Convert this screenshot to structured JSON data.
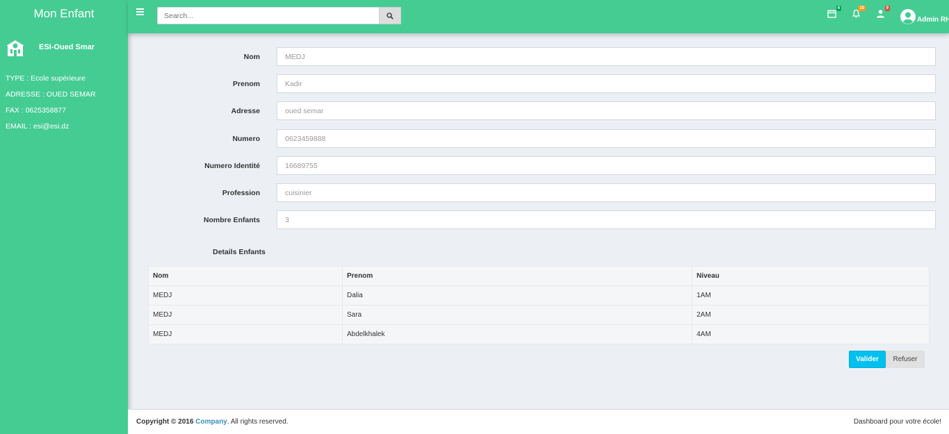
{
  "app": {
    "brand": "Mon Enfant",
    "accent": "#45cc93"
  },
  "sidebar": {
    "school_name": "ESI-Oued Smar",
    "school_icon": "school-icon",
    "info": [
      "TYPE : Ecole supérieure",
      "ADRESSE : OUED SEMAR",
      "FAX : 0625358877",
      "EMAIL : esi@esi.dz"
    ]
  },
  "topbar": {
    "search_placeholder": "Search...",
    "badges": {
      "calendar": "4",
      "notifications": "10",
      "users": "9"
    },
    "badge_colors": {
      "calendar": "#00a65a",
      "notifications": "#f39c12",
      "users": "#dd4b39"
    },
    "user_label": "Admin RH"
  },
  "form": {
    "fields": [
      {
        "label": "Nom",
        "value": "MEDJ"
      },
      {
        "label": "Prenom",
        "value": "Kadir"
      },
      {
        "label": "Adresse",
        "value": "oued semar"
      },
      {
        "label": "Numero",
        "value": "0623459888"
      },
      {
        "label": "Numero Identité",
        "value": "16689755"
      },
      {
        "label": "Profession",
        "value": "cuisinier"
      },
      {
        "label": "Nombre Enfants",
        "value": "3"
      }
    ]
  },
  "children": {
    "title": "Details Enfants",
    "headers": [
      "Nom",
      "Prenom",
      "Niveau"
    ],
    "rows": [
      [
        "MEDJ",
        "Dalia",
        "1AM"
      ],
      [
        "MEDJ",
        "Sara",
        "2AM"
      ],
      [
        "MEDJ",
        "Abdelkhalek",
        "4AM"
      ]
    ]
  },
  "actions": {
    "validate": "Valider",
    "refuse": "Refuser"
  },
  "footer": {
    "copyright_prefix": "Copyright © 2016",
    "company": "Company",
    "rights": ". All rights reserved.",
    "tagline": "Dashboard pour votre école!"
  }
}
